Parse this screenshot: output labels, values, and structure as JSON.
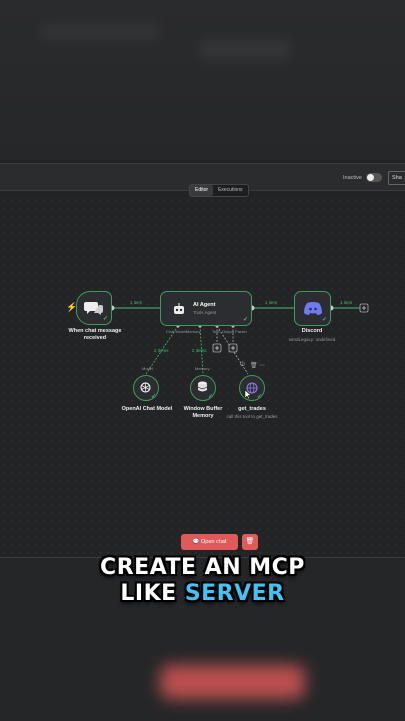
{
  "toolbar": {
    "status_label": "Inactive",
    "share_label": "Sha"
  },
  "tabs": [
    {
      "label": "Editor"
    },
    {
      "label": "Executions"
    }
  ],
  "nodes": {
    "trigger": {
      "title_line1": "When chat message",
      "title_line2": "received"
    },
    "agent": {
      "title": "AI Agent",
      "subtitle": "Tools Agent",
      "ports": [
        "Chat Model",
        "Memory",
        "Tool",
        "Output Parser"
      ]
    },
    "discord": {
      "title": "Discord",
      "subtitle": "sendLegacy: undefined"
    },
    "openai": {
      "title": "OpenAI Chat Model",
      "port": "Model"
    },
    "memory": {
      "title_line1": "Window Buffer",
      "title_line2": "Memory",
      "port": "Memory"
    },
    "tool": {
      "title": "get_trades",
      "subtitle": "call this tool to get_trades"
    }
  },
  "wires": {
    "trigger_agent": "1 item",
    "agent_discord": "1 item",
    "discord_out": "1 item",
    "model_items": "2 items",
    "memory_items": "2 items"
  },
  "buttons": {
    "open_chat": "Open chat",
    "trash_icon": "🗑"
  },
  "caption": {
    "line1": "CREATE AN MCP",
    "line2_a": "LIKE",
    "line2_b": "SERVER"
  },
  "colors": {
    "success": "#3fbf6f",
    "accent": "#e05a5a",
    "highlight": "#42c3f5"
  }
}
